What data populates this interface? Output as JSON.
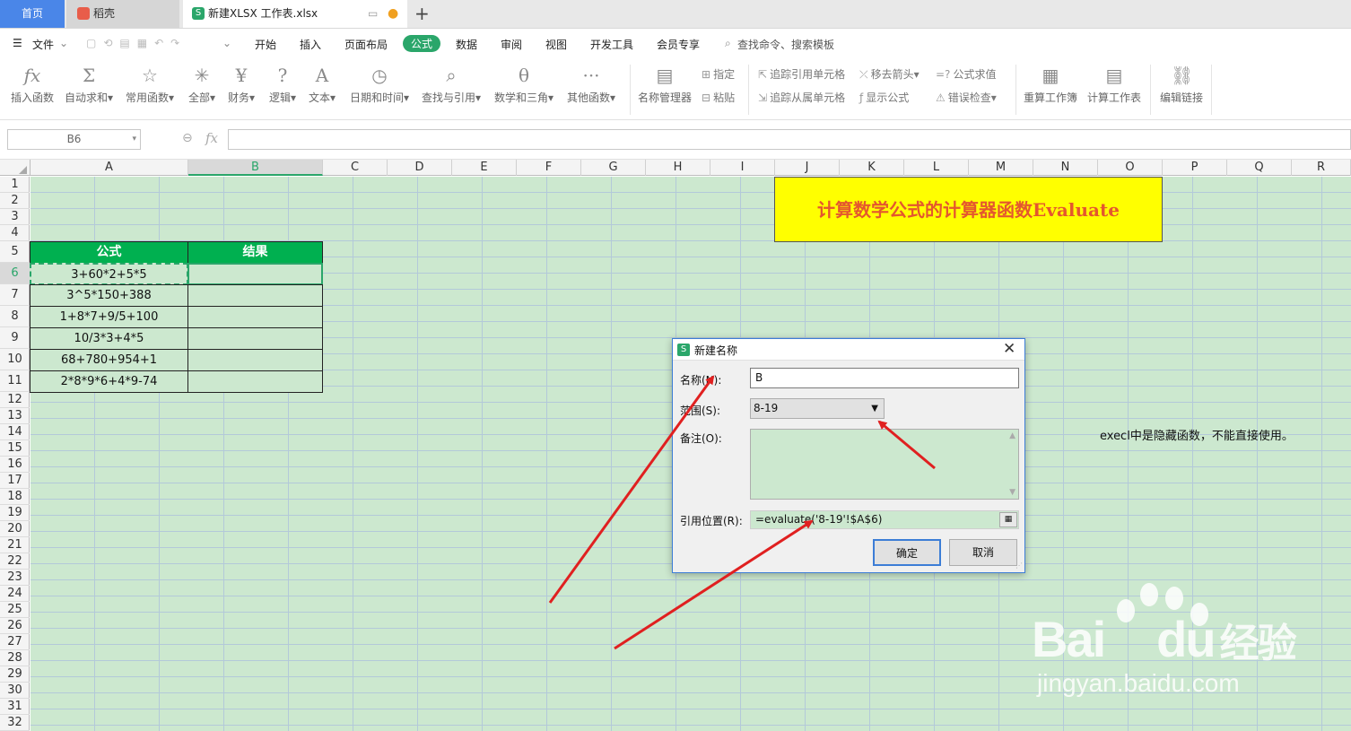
{
  "tabs": {
    "home": "首页",
    "daoke": "稻壳",
    "file": "新建XLSX 工作表.xlsx",
    "add": "+"
  },
  "menu": {
    "file": "文件",
    "items": [
      "开始",
      "插入",
      "页面布局",
      "公式",
      "数据",
      "审阅",
      "视图",
      "开发工具",
      "会员专享"
    ],
    "search": "查找命令、搜索模板"
  },
  "ribbon": {
    "insert_function": "插入函数",
    "autosum": "自动求和",
    "common": "常用函数",
    "all": "全部",
    "finance": "财务",
    "logic": "逻辑",
    "text": "文本",
    "datetime": "日期和时间",
    "lookup": "查找与引用",
    "math": "数学和三角",
    "other": "其他函数",
    "name_manager": "名称管理器",
    "assign": "指定",
    "paste": "粘贴",
    "trace_precedents": "追踪引用单元格",
    "trace_dependents": "追踪从属单元格",
    "remove_arrows": "移去箭头",
    "show_formulas": "显示公式",
    "eval_formula": "公式求值",
    "error_check": "错误检查",
    "recalc_workbook": "重算工作簿",
    "calc_sheet": "计算工作表",
    "edit_links": "编辑链接"
  },
  "formula_bar": {
    "name_box": "B6",
    "fx": "fx"
  },
  "columns": [
    "A",
    "B",
    "C",
    "D",
    "E",
    "F",
    "G",
    "H",
    "I",
    "J",
    "K",
    "L",
    "M",
    "N",
    "O",
    "P",
    "Q",
    "R"
  ],
  "rows": [
    "1",
    "2",
    "3",
    "4",
    "5",
    "6",
    "7",
    "8",
    "9",
    "10",
    "11",
    "12",
    "13",
    "14",
    "15",
    "16",
    "17",
    "18",
    "19",
    "20",
    "21",
    "22",
    "23",
    "24",
    "25",
    "26",
    "27",
    "28",
    "29",
    "30",
    "31",
    "32"
  ],
  "table": {
    "header_formula": "公式",
    "header_result": "结果",
    "formulas": [
      "3+60*2+5*5",
      "3^5*150+388",
      "1+8*7+9/5+100",
      "10/3*3+4*5",
      "68+780+954+1",
      "2*8*9*6+4*9-74"
    ]
  },
  "title_box": "计算数学公式的计算器函数Evaluate",
  "note": "execl中是隐藏函数，不能直接使用。",
  "dialog": {
    "title": "新建名称",
    "name_label": "名称(N):",
    "name_value": "B",
    "scope_label": "范围(S):",
    "scope_value": "8-19",
    "comment_label": "备注(O):",
    "ref_label": "引用位置(R):",
    "ref_value": "=evaluate('8-19'!$A$6)",
    "ok": "确定",
    "cancel": "取消"
  },
  "watermark": {
    "brand": "Bai",
    "brand2": "du",
    "cn": "经验",
    "url": "jingyan.baidu.com"
  },
  "colors": {
    "accent": "#2aa66a",
    "header_green": "#00b050",
    "sheet_bg": "#cce8cf",
    "title_fill": "#ffff00",
    "title_text": "#e4572e",
    "arrow": "#e02020"
  }
}
